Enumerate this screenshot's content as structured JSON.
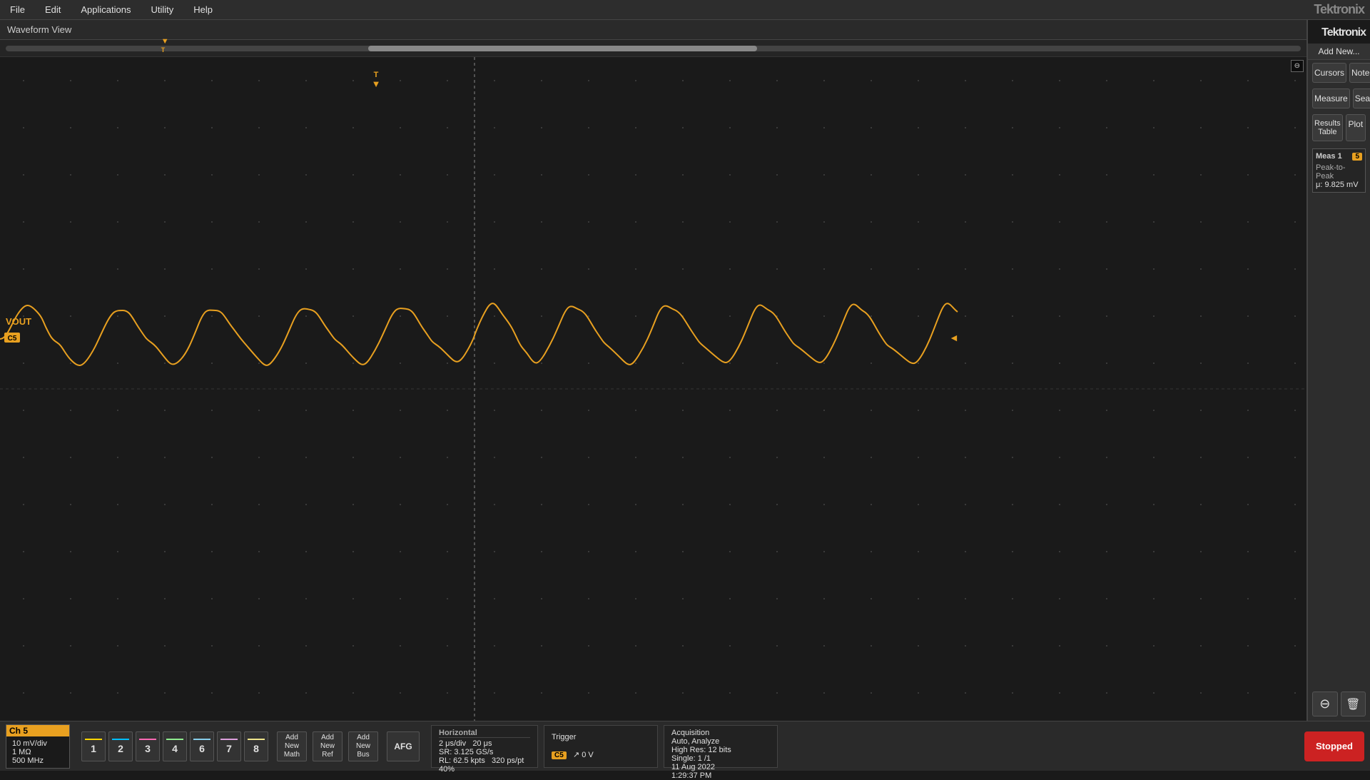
{
  "app": {
    "title": "Tektronix",
    "add_new": "Add New..."
  },
  "menubar": {
    "items": [
      "File",
      "Edit",
      "Applications",
      "Utility",
      "Help"
    ]
  },
  "waveform_view": {
    "title": "Waveform View"
  },
  "right_panel": {
    "cursors": "Cursors",
    "note": "Note",
    "measure": "Measure",
    "search": "Search",
    "results_table": "Results Table",
    "plot": "Plot",
    "meas1": {
      "title": "Meas 1",
      "type": "Peak-to-Peak",
      "value": "μ: 9.825 mV"
    },
    "zoom_icon": "⊖",
    "trash_icon": "🗑"
  },
  "channel": {
    "name": "VOUT",
    "badge": "C5",
    "color": "#e8a020"
  },
  "bottom_bar": {
    "ch5": {
      "label": "Ch 5",
      "vol_div": "10 mV/div",
      "impedance": "1 MΩ",
      "sample_rate": "500 MHz"
    },
    "channels": [
      {
        "num": "1",
        "class": "ch1"
      },
      {
        "num": "2",
        "class": "ch2"
      },
      {
        "num": "3",
        "class": "ch3"
      },
      {
        "num": "4",
        "class": "ch4"
      },
      {
        "num": "6",
        "class": "ch6"
      },
      {
        "num": "7",
        "class": "ch7"
      },
      {
        "num": "8",
        "class": "ch8"
      }
    ],
    "add_math": "Add\nNew\nMath",
    "add_ref": "Add\nNew\nRef",
    "add_bus": "Add\nNew\nBus",
    "afg": "AFG",
    "horizontal": {
      "title": "Horizontal",
      "time_div": "2 μs/div",
      "horiz_pos": "20 μs",
      "sr": "SR: 3.125 GS/s",
      "rl": "RL: 62.5 kpts",
      "ps_pt": "320 ps/pt",
      "zoom": "40%"
    },
    "trigger": {
      "title": "Trigger",
      "ch_badge": "C5",
      "level": "↗ 0 V"
    },
    "acquisition": {
      "title": "Acquisition",
      "mode": "Auto, Analyze",
      "bits": "High Res: 12 bits",
      "single": "Single: 1 /1",
      "date": "11 Aug 2022",
      "time": "1:29:37 PM"
    },
    "stopped": "Stopped"
  }
}
